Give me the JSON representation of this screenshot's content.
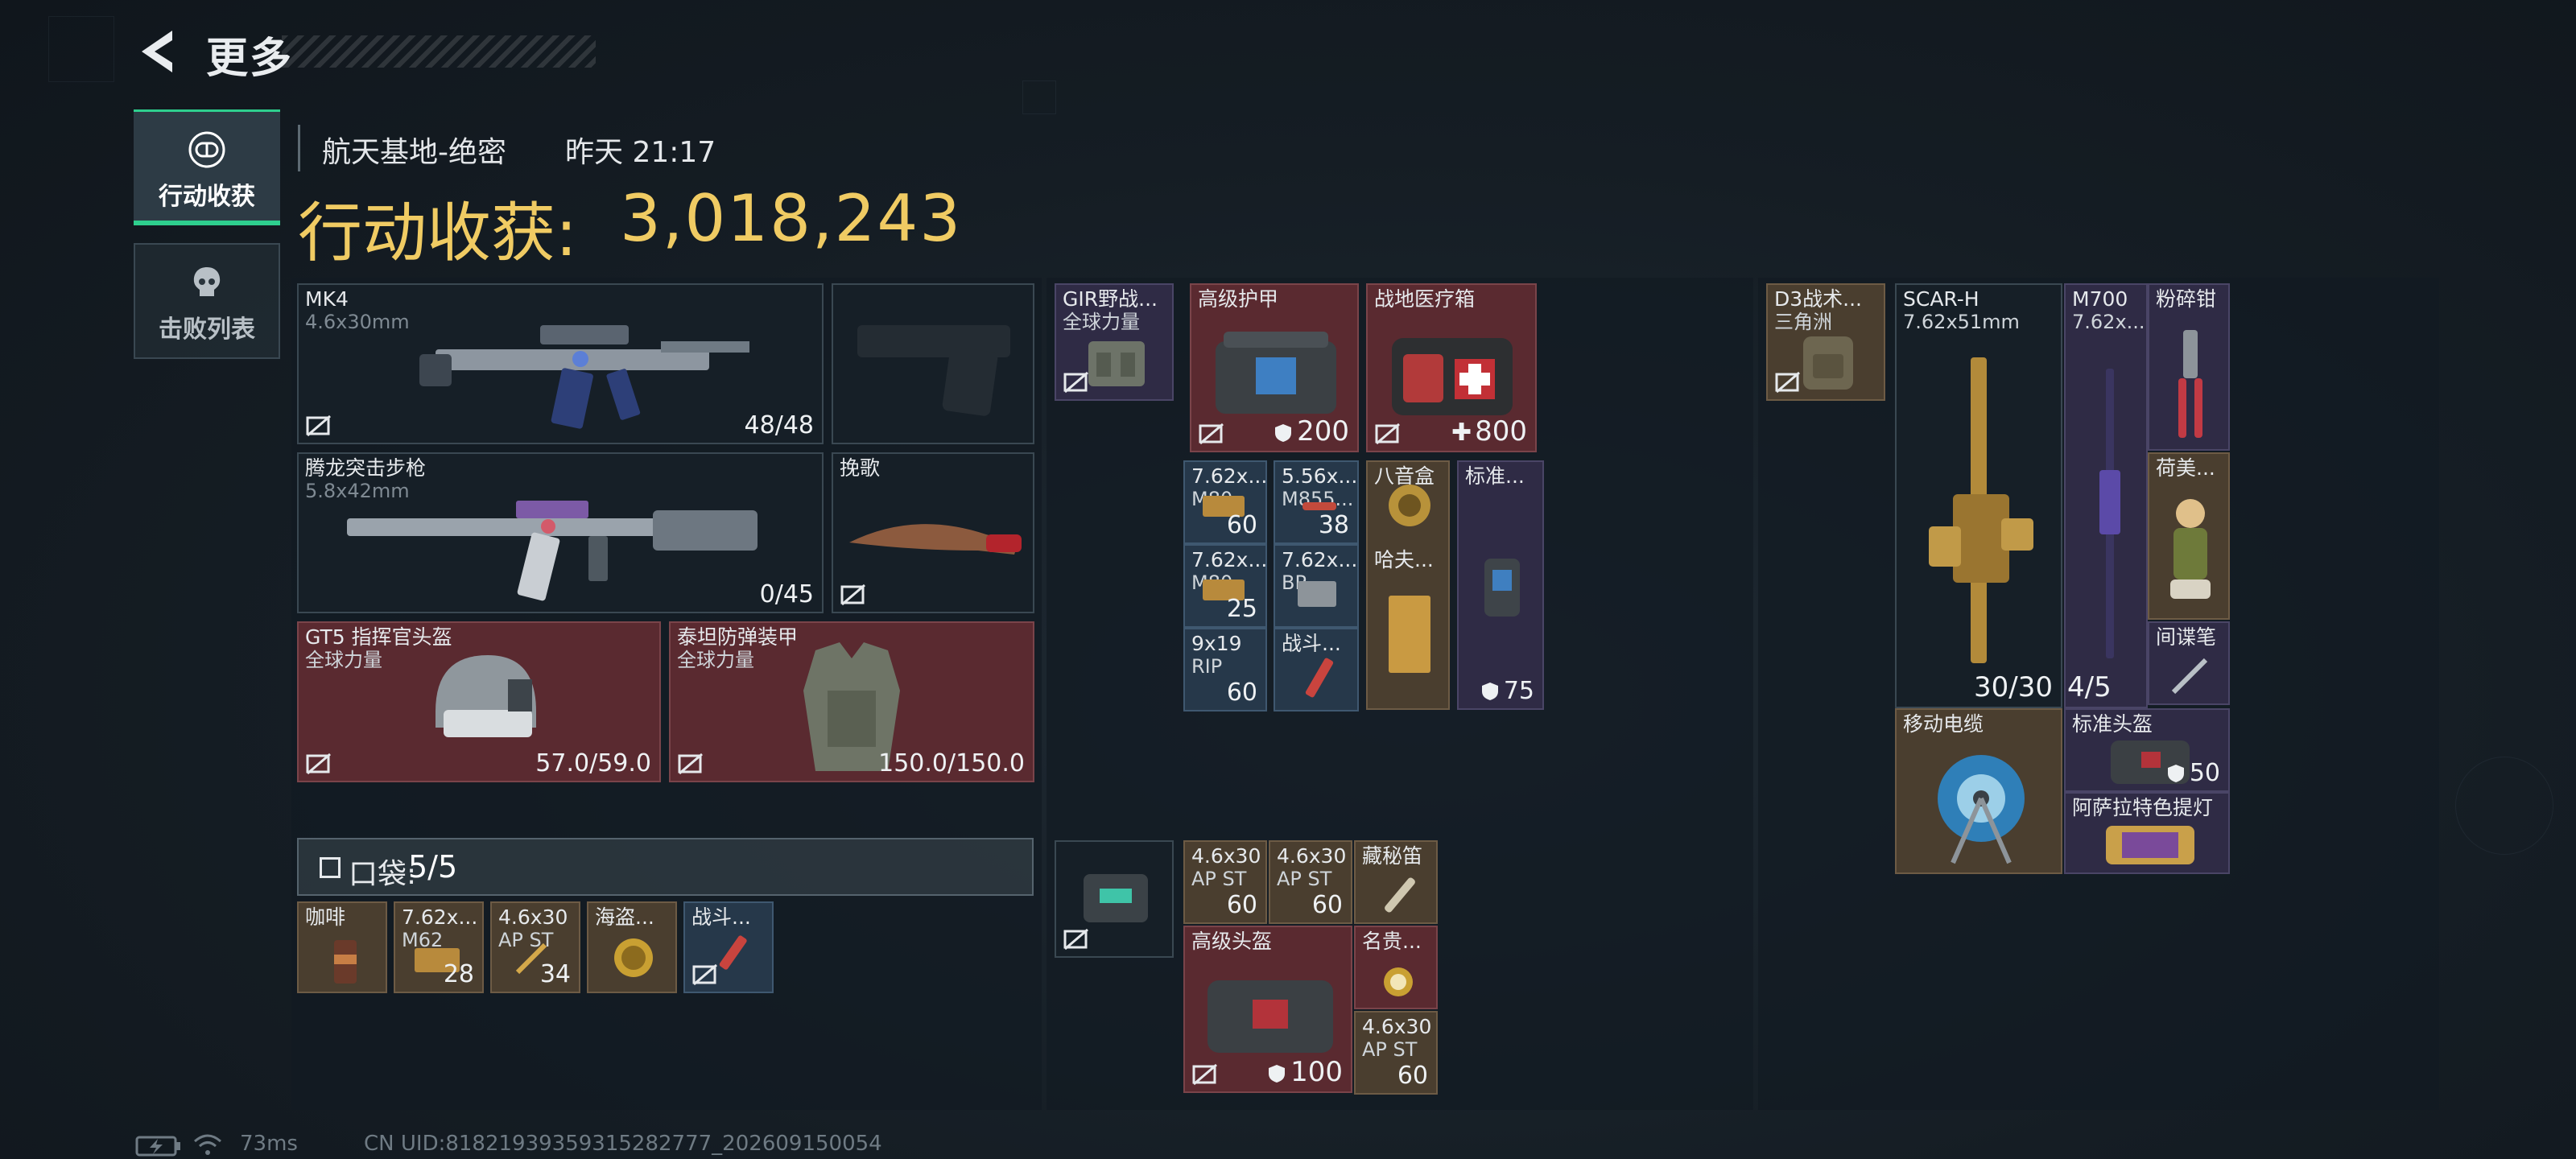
{
  "header": {
    "back_title": "更多"
  },
  "tabs": [
    {
      "label": "行动收获",
      "icon": "capsule-icon",
      "active": true
    },
    {
      "label": "击败列表",
      "icon": "skull-icon",
      "active": false
    }
  ],
  "info": {
    "location": "航天基地-绝密",
    "time": "昨天 21:17"
  },
  "gain": {
    "label": "行动收获:",
    "value": "3,018,243"
  },
  "loadout": {
    "primary": {
      "name": "MK4",
      "caliber": "4.6x30mm",
      "ammo": "48/48"
    },
    "pistol": {
      "name": "",
      "icon": "pistol-silhouette-icon"
    },
    "secondary": {
      "name": "腾龙突击步枪",
      "caliber": "5.8x42mm",
      "ammo": "0/45"
    },
    "melee": {
      "name": "挽歌"
    },
    "helmet": {
      "name": "GT5 指挥官头盔",
      "tag": "全球力量",
      "durability": "57.0/59.0"
    },
    "armor": {
      "name": "泰坦防弹装甲",
      "tag": "全球力量",
      "durability": "150.0/150.0"
    }
  },
  "pocket": {
    "label": "口袋:",
    "value": "5/5"
  },
  "pocket_items": [
    {
      "name": "咖啡",
      "sub": "",
      "count": ""
    },
    {
      "name": "7.62x...",
      "sub": "M62",
      "count": "28"
    },
    {
      "name": "4.6x30",
      "sub": "AP ST",
      "count": "34"
    },
    {
      "name": "海盗...",
      "sub": "",
      "count": ""
    },
    {
      "name": "战斗...",
      "sub": "",
      "count": ""
    }
  ],
  "chest_rig": {
    "name": "GIR野战...",
    "tag": "全球力量"
  },
  "rig_items": {
    "armor": {
      "name": "高级护甲",
      "value": "200"
    },
    "medkit": {
      "name": "战地医疗箱",
      "value": "800"
    },
    "a1": {
      "name": "7.62x...",
      "sub": "M80",
      "count": "60"
    },
    "a2": {
      "name": "5.56x...",
      "sub": "M855...",
      "count": "38"
    },
    "a3": {
      "name": "八音盒",
      "sub": "",
      "count": ""
    },
    "a4": {
      "name": "标准...",
      "value": "75"
    },
    "a5": {
      "name": "7.62x...",
      "sub": "M80",
      "count": "25"
    },
    "a6": {
      "name": "7.62x...",
      "sub": "BP",
      "count": ""
    },
    "a7": {
      "name": "哈夫...",
      "sub": "",
      "count": ""
    },
    "a8": {
      "name": "9x19",
      "sub": "RIP",
      "count": "60"
    },
    "a9": {
      "name": "战斗...",
      "sub": "",
      "count": ""
    }
  },
  "bag_items": {
    "b1": {
      "name": "4.6x30",
      "sub": "AP ST",
      "count": "60"
    },
    "b2": {
      "name": "4.6x30",
      "sub": "AP ST",
      "count": "60"
    },
    "b3": {
      "name": "藏秘笛",
      "sub": "",
      "count": ""
    },
    "b4": {
      "name": "高级头盔",
      "value": "100"
    },
    "b5": {
      "name": "名贵...",
      "sub": "",
      "count": ""
    },
    "b6": {
      "name": "4.6x30",
      "sub": "AP ST",
      "count": "60"
    }
  },
  "backpack": {
    "name": "D3战术...",
    "tag": "三角洲"
  },
  "backpack_items": {
    "scar": {
      "name": "SCAR-H",
      "caliber": "7.62x51mm",
      "ammo": "30/30"
    },
    "m700": {
      "name": "M700",
      "caliber": "7.62x...",
      "ammo": "4/5"
    },
    "pliers": {
      "name": "粉碎钳"
    },
    "figure": {
      "name": "荷美..."
    },
    "spy": {
      "name": "间谍笔"
    },
    "cable": {
      "name": "移动电缆"
    },
    "helmet": {
      "name": "标准头盔",
      "value": "50"
    },
    "lamp": {
      "name": "阿萨拉特色提灯"
    }
  },
  "status": {
    "ping": "73ms",
    "uid": "CN UID:81821939359315282777_202609150054"
  },
  "colors": {
    "accent_gold": "#f0cb63",
    "active_tab": "#2ecf8e",
    "red_slot": "#5a2a30"
  }
}
